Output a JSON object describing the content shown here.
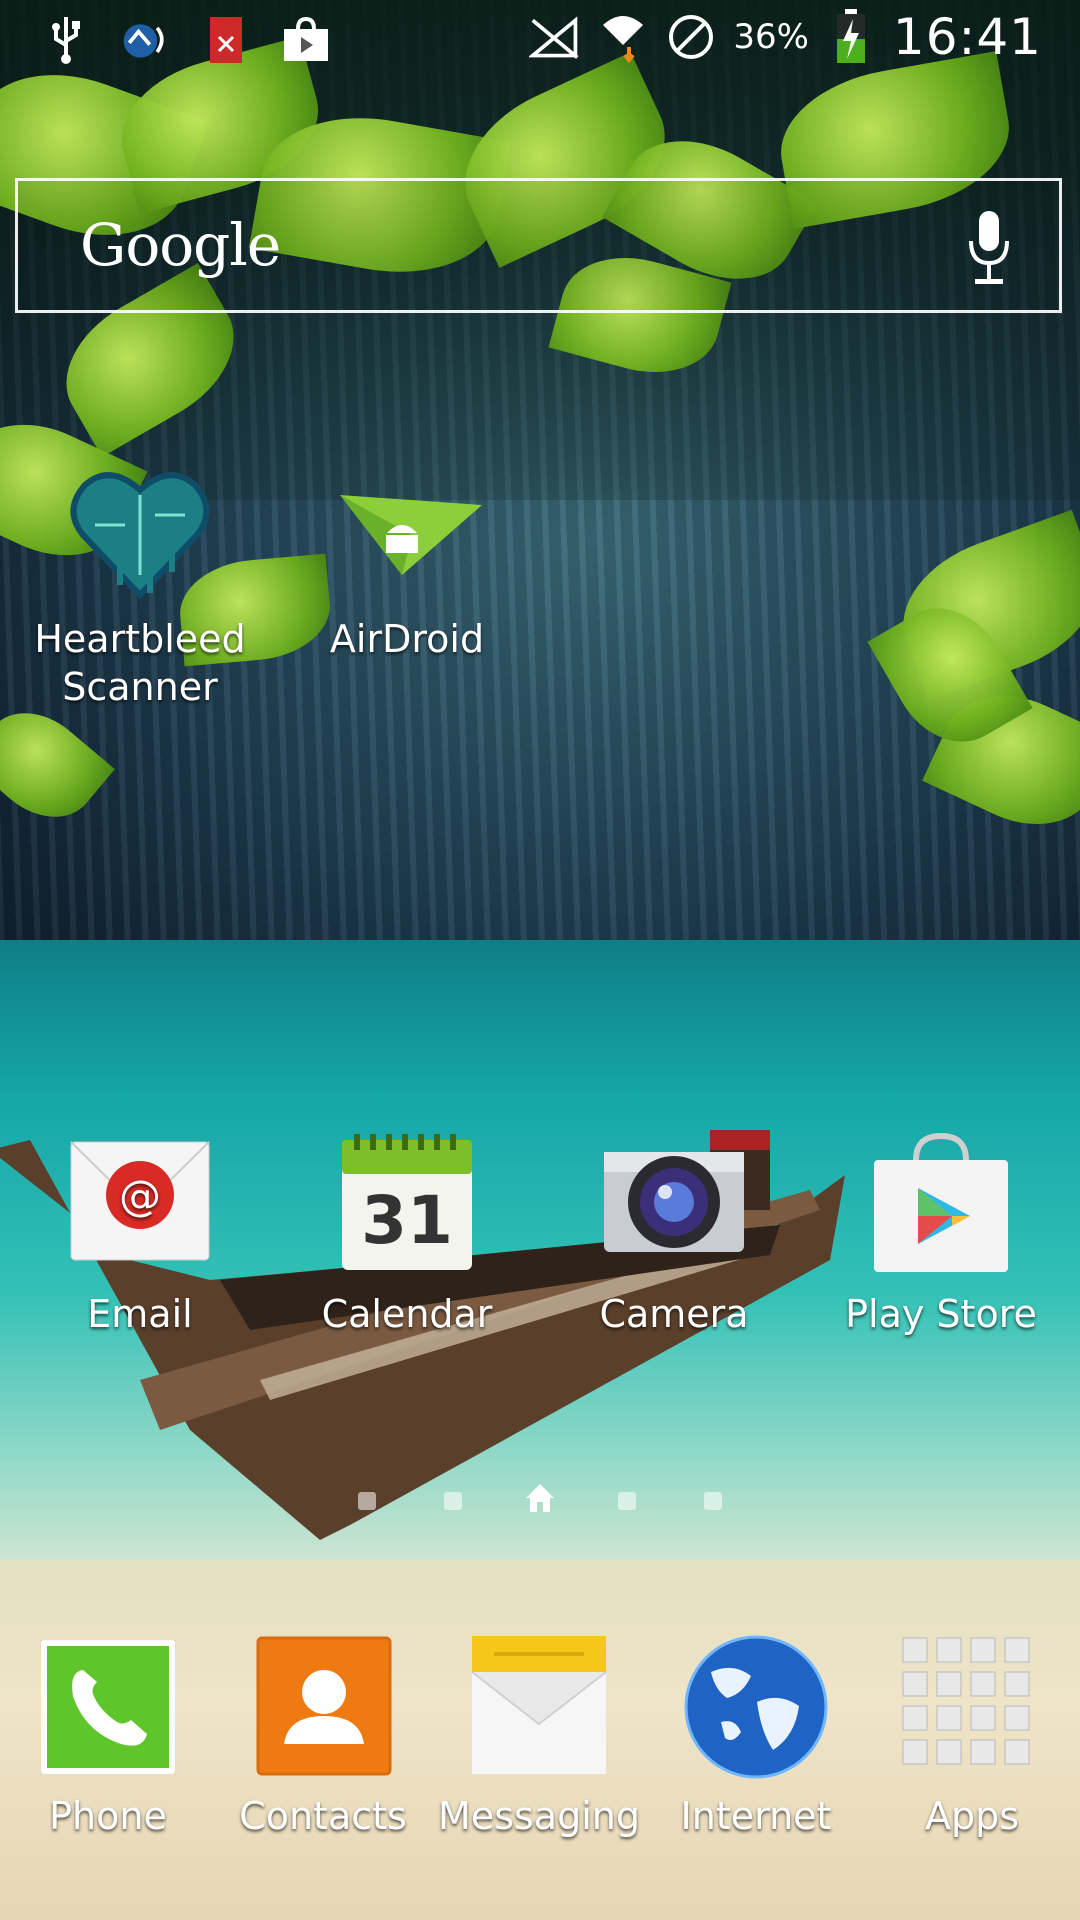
{
  "status_bar": {
    "battery_percent": "36%",
    "time": "16:41",
    "left_icons": [
      "usb-icon",
      "airdroid-status-icon",
      "file-error-icon",
      "store-bag-icon"
    ],
    "right_icons": [
      "no-signal-icon",
      "wifi-icon",
      "blocked-icon",
      "battery-charging-icon"
    ]
  },
  "search": {
    "logo_text": "Google",
    "mic_icon": "mic-icon"
  },
  "desktop_apps": [
    {
      "label": "Heartbleed Scanner",
      "icon": "heartbleed-icon"
    },
    {
      "label": "AirDroid",
      "icon": "airdroid-icon"
    }
  ],
  "home_row_apps": [
    {
      "label": "Email",
      "icon": "email-icon"
    },
    {
      "label": "Calendar",
      "icon": "calendar-icon",
      "day": "31"
    },
    {
      "label": "Camera",
      "icon": "camera-icon"
    },
    {
      "label": "Play Store",
      "icon": "play-store-icon"
    }
  ],
  "page_indicator": {
    "page_count": 5,
    "current_page": 3,
    "home_icon": "home-icon"
  },
  "dock": [
    {
      "label": "Phone",
      "icon": "phone-icon"
    },
    {
      "label": "Contacts",
      "icon": "contacts-icon"
    },
    {
      "label": "Messaging",
      "icon": "messaging-icon"
    },
    {
      "label": "Internet",
      "icon": "globe-icon"
    },
    {
      "label": "Apps",
      "icon": "apps-grid-icon"
    }
  ],
  "colors": {
    "water": "#15a7a8",
    "leaf": "#6fb11d",
    "battery_charge": "#4caf1f"
  }
}
